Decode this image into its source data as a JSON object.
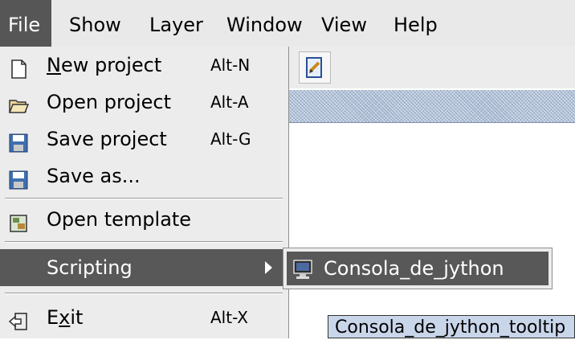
{
  "menubar": {
    "items": [
      {
        "label": "File"
      },
      {
        "label": "Show"
      },
      {
        "label": "Layer"
      },
      {
        "label": "Window"
      },
      {
        "label": "View"
      },
      {
        "label": "Help"
      }
    ]
  },
  "file_menu": {
    "new_project": {
      "mnemonic": "N",
      "label_rest": "ew project",
      "accel": "Alt-N",
      "icon": "new-document-icon"
    },
    "open_project": {
      "label": "Open project",
      "accel": "Alt-A",
      "icon": "folder-open-icon"
    },
    "save_project": {
      "label": "Save project",
      "accel": "Alt-G",
      "icon": "floppy-disk-icon"
    },
    "save_as": {
      "label": "Save as...",
      "icon": "floppy-disk-icon"
    },
    "open_template": {
      "label": "Open template",
      "icon": "template-icon"
    },
    "scripting": {
      "label": "Scripting",
      "icon": "submenu-arrow-icon"
    },
    "exit": {
      "label_start": "E",
      "mnemonic": "x",
      "label_rest": "it",
      "accel": "Alt-X",
      "icon": "exit-icon"
    }
  },
  "scripting_submenu": {
    "items": [
      {
        "label": "Consola_de_jython",
        "icon": "console-monitor-icon"
      }
    ]
  },
  "tooltip": {
    "text": "Consola_de_jython_tooltip"
  },
  "colors": {
    "menu_background": "#ececec",
    "highlight": "#585858",
    "tooltip_background": "#c9d6ea",
    "stripe": "#9aaec9"
  }
}
